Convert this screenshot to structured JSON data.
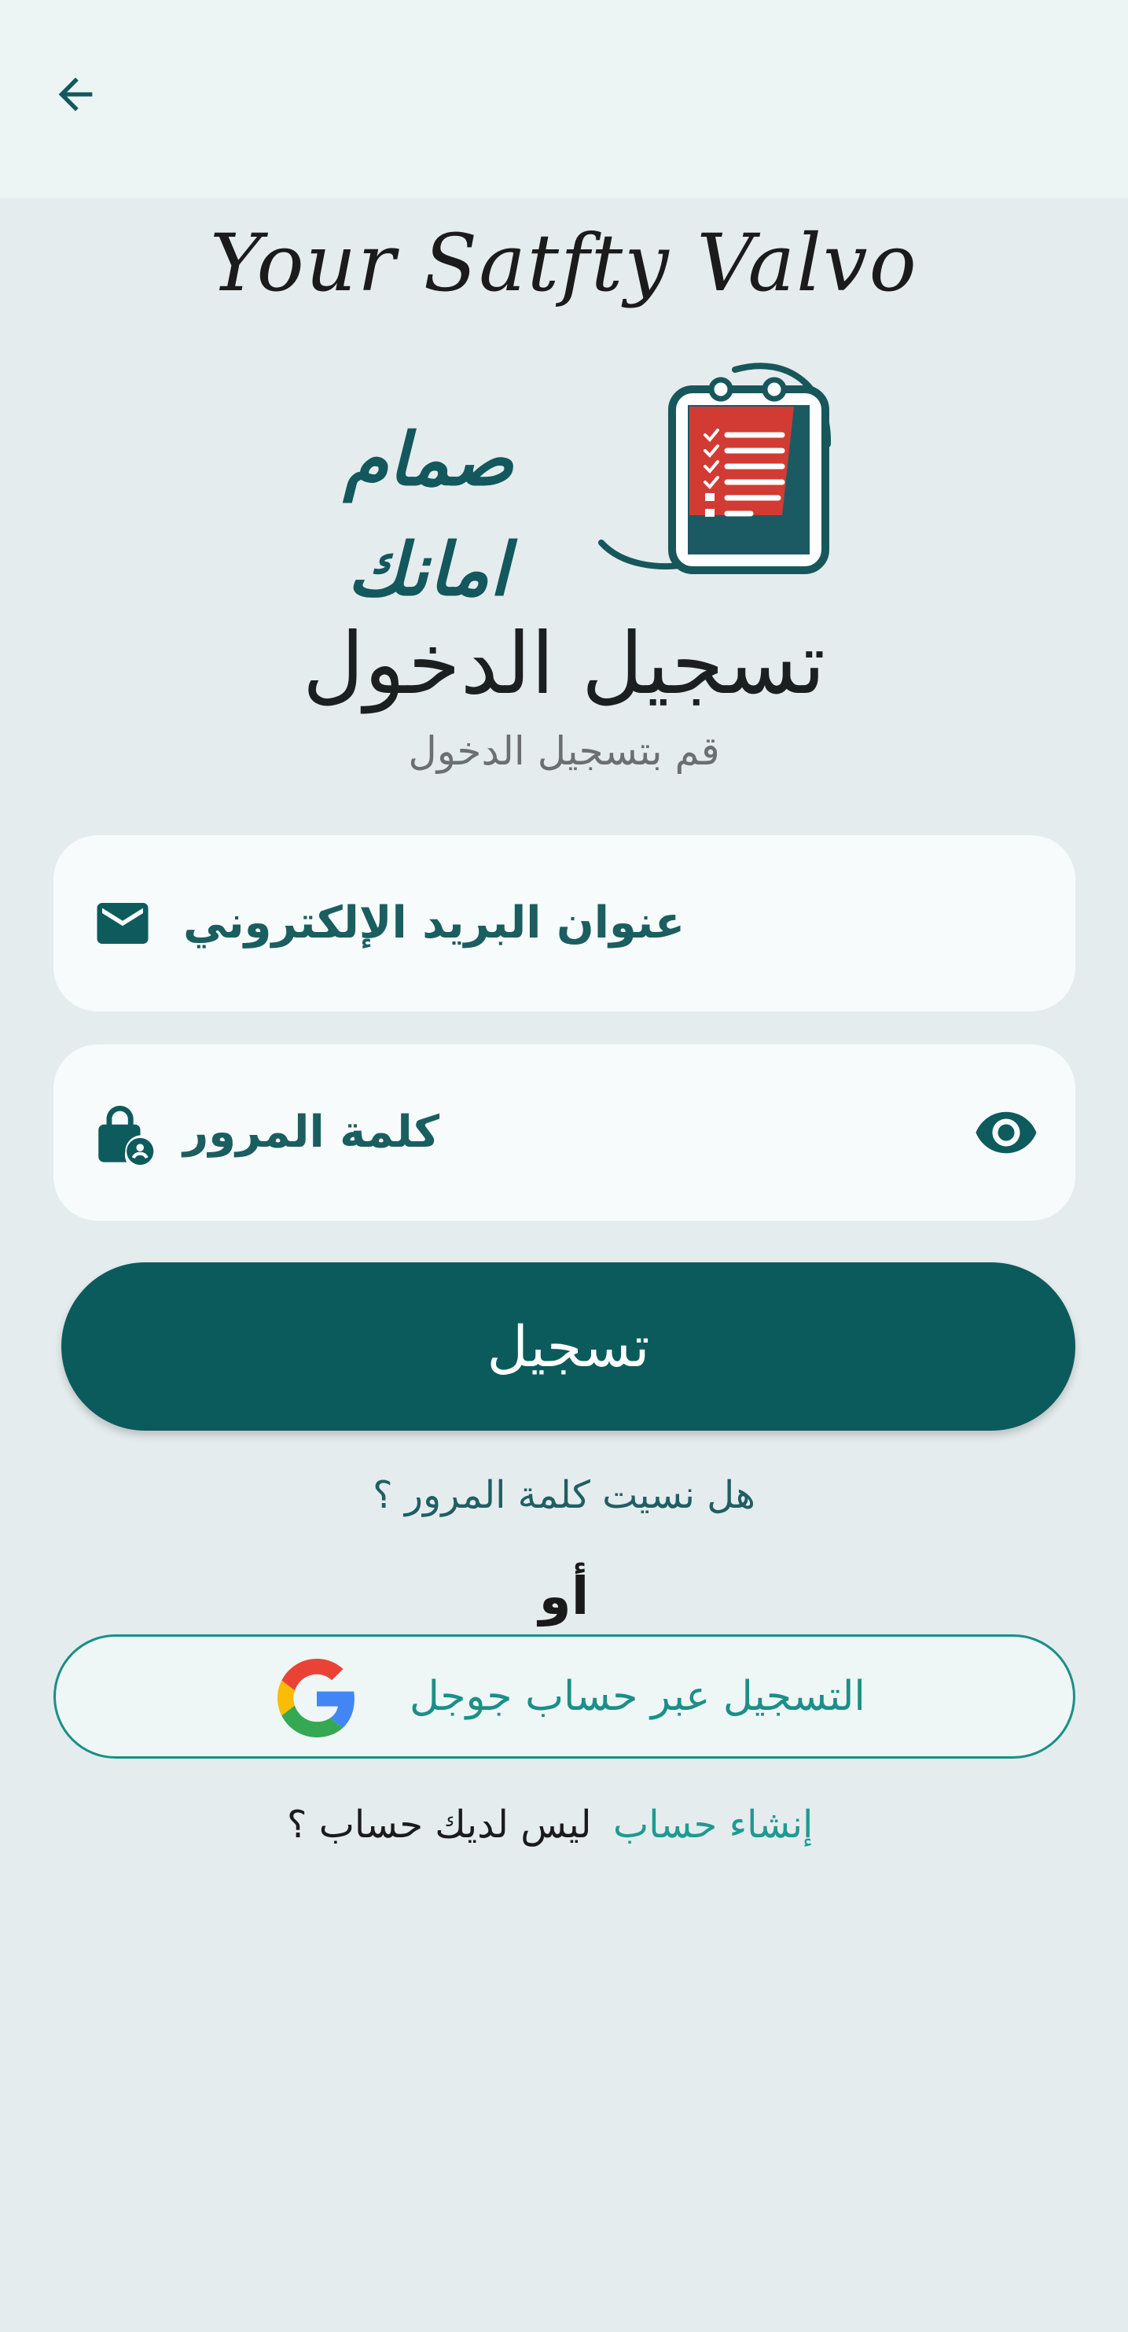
{
  "app": {
    "tagline": "Your Satfty Valvo",
    "logo_text": "صمام امانك"
  },
  "header": {
    "back_icon": "arrow-back-icon"
  },
  "main": {
    "title": "تسجيل الدخول",
    "subtitle": "قم بتسجيل الدخول"
  },
  "form": {
    "email": {
      "placeholder": "عنوان البريد الإلكتروني",
      "icon": "mail-icon"
    },
    "password": {
      "placeholder": "كلمة المرور",
      "icon": "lock-person-icon",
      "toggle_icon": "eye-icon"
    },
    "submit_label": "تسجيل",
    "forgot_label": "هل نسيت كلمة المرور ؟",
    "or_label": "أو",
    "google_label": "التسجيل عبر حساب جوجل",
    "google_icon": "google-g-icon"
  },
  "footer": {
    "no_account_label": "ليس لديك حساب ؟",
    "create_account_label": "إنشاء حساب"
  },
  "colors": {
    "primary": "#0b5b5d",
    "accent": "#1e9a91",
    "background": "#e5ecee",
    "appbar": "#edf5f4",
    "field_bg": "#f8fbfb",
    "logo_red": "#d23b33"
  }
}
